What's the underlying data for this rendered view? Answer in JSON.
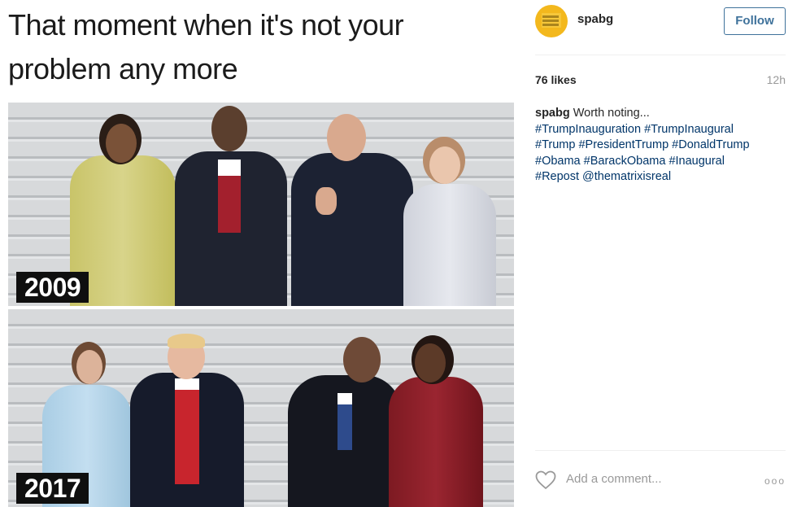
{
  "meme": {
    "caption": "That moment when it's not your problem any more",
    "year_top": "2009",
    "year_bottom": "2017"
  },
  "post": {
    "username": "spabg",
    "follow_label": "Follow",
    "likes": "76 likes",
    "time": "12h",
    "author": "spabg",
    "text": "Worth noting...",
    "hashtags": [
      "#TrumpInauguration",
      "#TrumpInaugural",
      "#Trump",
      "#PresidentTrump",
      "#DonaldTrump",
      "#Obama",
      "#BarackObama",
      "#Inaugural",
      "#Repost",
      "@thematrixisreal"
    ],
    "comment_placeholder": "Add a comment...",
    "more_label": "ooo"
  },
  "colors": {
    "follow_blue": "#3f729b",
    "link_blue": "#003569",
    "avatar_yellow": "#f3b81d"
  }
}
